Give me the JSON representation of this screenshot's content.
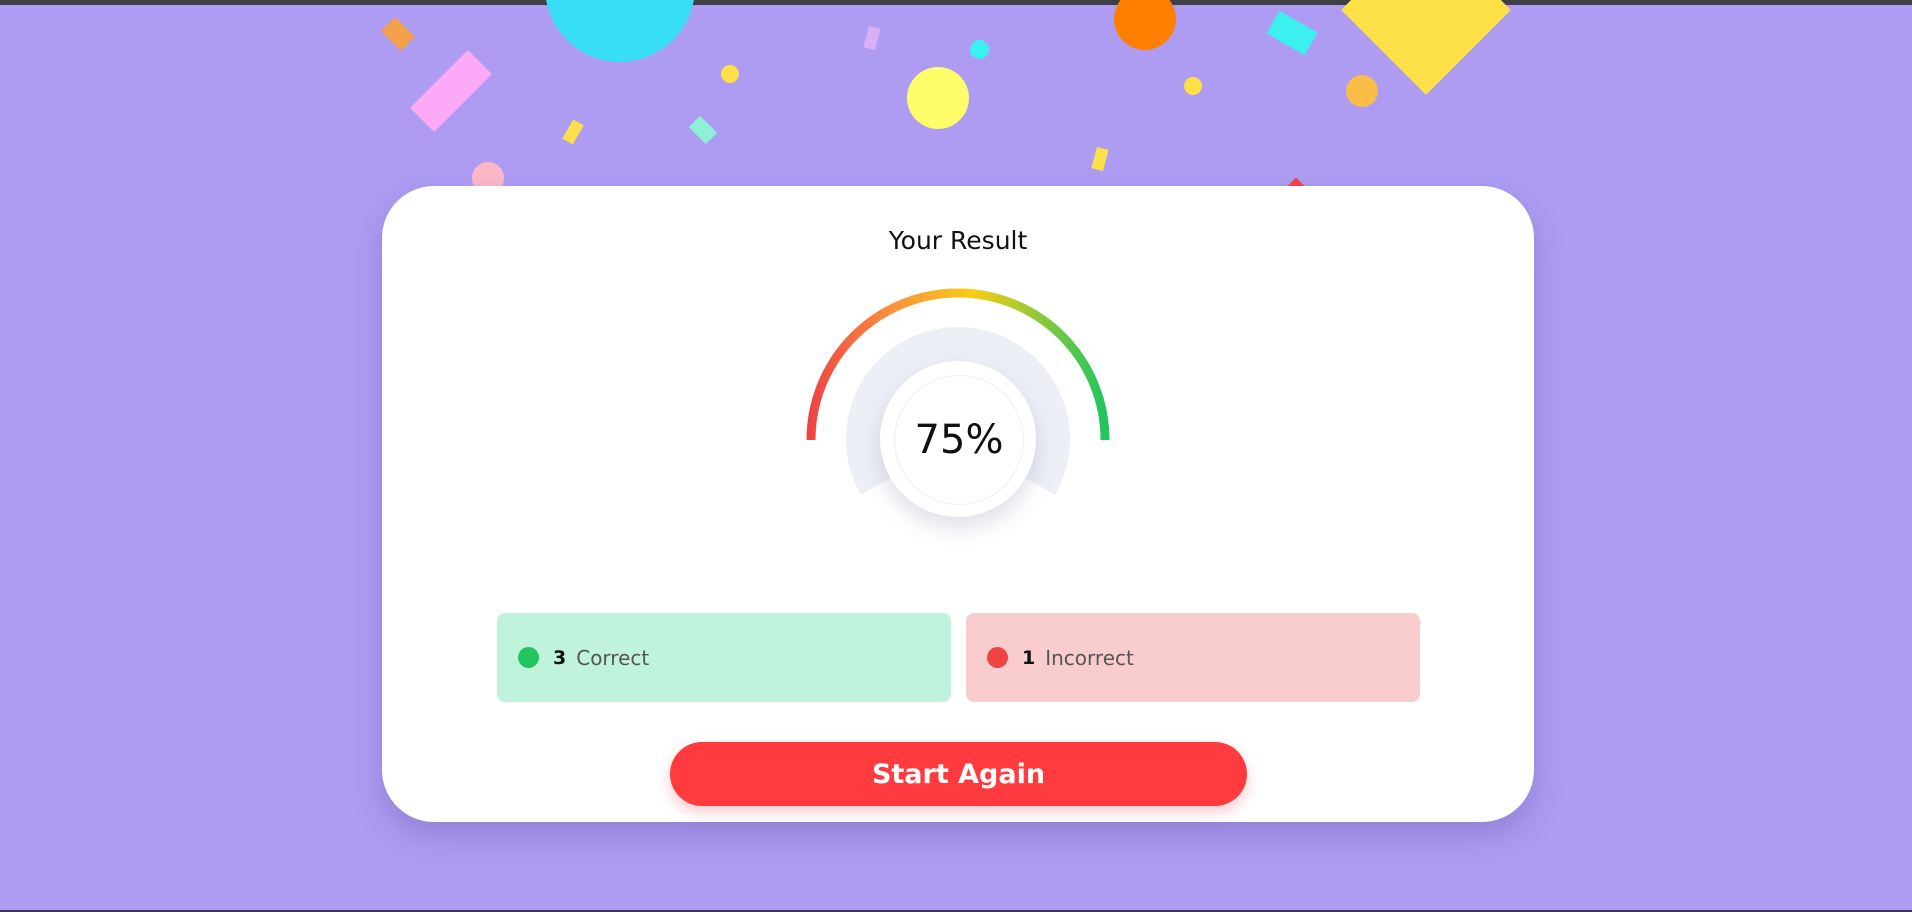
{
  "result": {
    "title": "Your Result",
    "score_percent": 75,
    "score_label": "75%"
  },
  "stats": {
    "correct": {
      "count": "3",
      "label": "Correct",
      "dot_color": "#22c55e"
    },
    "incorrect": {
      "count": "1",
      "label": "Incorrect",
      "dot_color": "#ef4444"
    }
  },
  "actions": {
    "start_again_label": "Start Again"
  },
  "colors": {
    "background": "#ad9cf2",
    "card": "#ffffff",
    "button": "#ff3b3f",
    "correct_bg": "#c0f3db",
    "incorrect_bg": "#f9cdcd",
    "gauge_gradient": [
      "#ef4444",
      "#fb923c",
      "#facc15",
      "#22c55e"
    ]
  }
}
